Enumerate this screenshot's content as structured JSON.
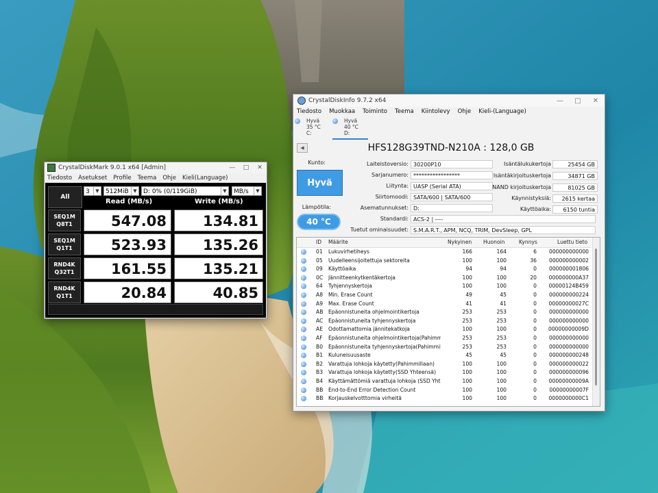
{
  "colors": {
    "accent": "#3f9be3",
    "benchmark_bg": "#000000",
    "health_good": "#3f9be3"
  },
  "crystaldiskmark": {
    "title": "CrystalDiskMark 9.0.1 x64 [Admin]",
    "window_buttons": [
      "—",
      "□",
      "✕"
    ],
    "menu": [
      "Tiedosto",
      "Asetukset",
      "Profile",
      "Teema",
      "Ohje",
      "Kieli(Language)"
    ],
    "all_label": "All",
    "count": "3",
    "size": "512MiB",
    "drive": "D: 0% (0/119GiB)",
    "unit": "MB/s",
    "header_read": "Read (MB/s)",
    "header_write": "Write (MB/s)",
    "rows": [
      {
        "line1": "SEQ1M",
        "line2": "Q8T1",
        "read": "547.08",
        "write": "134.81"
      },
      {
        "line1": "SEQ1M",
        "line2": "Q1T1",
        "read": "523.93",
        "write": "135.26"
      },
      {
        "line1": "RND4K",
        "line2": "Q32T1",
        "read": "161.55",
        "write": "135.21"
      },
      {
        "line1": "RND4K",
        "line2": "Q1T1",
        "read": "20.84",
        "write": "40.85"
      }
    ]
  },
  "crystaldiskinfo": {
    "title": "CrystalDiskInfo 9.7.2 x64",
    "window_buttons": [
      "—",
      "□",
      "✕"
    ],
    "menu": [
      "Tiedosto",
      "Muokkaa",
      "Toiminto",
      "Teema",
      "Kiintolevy",
      "Ohje",
      "Kieli-(Language)"
    ],
    "drives": [
      {
        "status": "Hyvä",
        "temp": "35 °C",
        "letter": "C:"
      },
      {
        "status": "Hyvä",
        "temp": "40 °C",
        "letter": "D:"
      }
    ],
    "model": "HFS128G39TND-N210A : 128,0 GB",
    "health_label": "Kunto:",
    "health": "Hyvä",
    "temp_label": "Lämpötila:",
    "temp": "40 °C",
    "firmware_label": "Laiteistoversio:",
    "firmware": "30200P10",
    "serial_label": "Sarjanumero:",
    "serial": "*****************",
    "interface_label": "Liitynta:",
    "interface": "UASP (Serial ATA)",
    "transfer_label": "Siirtomoodi:",
    "transfer": "SATA/600 | SATA/600",
    "drive_letter_label": "Asematunnukset:",
    "drive_letter": "D:",
    "standard_label": "Standardi:",
    "standard": "ACS-2 | ----",
    "features_label": "Tuetut ominaisuudet:",
    "features": "S.M.A.R.T., APM, NCQ, TRIM, DevSleep, GPL",
    "host_reads_label": "Isäntälukukertoja",
    "host_reads": "25454 GB",
    "host_writes_label": "Isäntäkirjoituskertoja",
    "host_writes": "34871 GB",
    "nand_writes_label": "NAND kirjoituskertoja",
    "nand_writes": "81025 GB",
    "power_on_count_label": "Käynnistyksiä:",
    "power_on_count": "2615 kertaa",
    "power_on_hours_label": "Käyttöaika:",
    "power_on_hours": "6150 tuntia",
    "smart_headers": [
      "ID",
      "Määrite",
      "Nykyinen",
      "Huonoin",
      "Kynnys",
      "Luettu tieto"
    ],
    "smart": [
      [
        "01",
        "Lukuvirhetiheys",
        "166",
        "164",
        "6",
        "000000000000"
      ],
      [
        "05",
        "Uudelleensijoitettuja sektoreita",
        "100",
        "100",
        "36",
        "000000000002"
      ],
      [
        "09",
        "Käyttöaika",
        "94",
        "94",
        "0",
        "000000001806"
      ],
      [
        "0C",
        "Jännitteenkytkentäkertoja",
        "100",
        "100",
        "20",
        "000000000A37"
      ],
      [
        "64",
        "Tyhjennyskertoja",
        "100",
        "100",
        "0",
        "00000124B459"
      ],
      [
        "A8",
        "Min. Erase Count",
        "49",
        "45",
        "0",
        "000000000224"
      ],
      [
        "A9",
        "Max. Erase Count",
        "41",
        "41",
        "0",
        "00000000027C"
      ],
      [
        "AB",
        "Epäonnistuneita ohjelmointikertoja",
        "253",
        "253",
        "0",
        "000000000000"
      ],
      [
        "AC",
        "Epäonnistuneita tyhjennyskertoja",
        "253",
        "253",
        "0",
        "000000000000"
      ],
      [
        "AE",
        "Odottamattomia jännitekatkoja",
        "100",
        "100",
        "0",
        "00000000009D"
      ],
      [
        "AF",
        "Epäonnistuneita ohjelmointikertoja(Pahimm...",
        "253",
        "253",
        "0",
        "000000000000"
      ],
      [
        "B0",
        "Epäonnistuneita tyhjennyskertoja(Pahimmil...",
        "253",
        "253",
        "0",
        "000000000000"
      ],
      [
        "B1",
        "Kuluneisuusaste",
        "45",
        "45",
        "0",
        "000000000248"
      ],
      [
        "B2",
        "Varattuja lohkoja käytetty(Pahimmillaan)",
        "100",
        "100",
        "0",
        "000000000022"
      ],
      [
        "B3",
        "Varattuja lohkoja käytetty(SSD Yhteensä)",
        "100",
        "100",
        "0",
        "000000000096"
      ],
      [
        "B4",
        "Käyttämättömiä varattuja lohkoja (SSD Yhte...",
        "100",
        "100",
        "0",
        "00000000009A"
      ],
      [
        "BB",
        "End-to-End Error Detection Count",
        "100",
        "100",
        "0",
        "00000000007F"
      ],
      [
        "BB",
        "Korjauskelvotttomia virheitä",
        "100",
        "100",
        "0",
        "0000000000C1"
      ]
    ]
  }
}
